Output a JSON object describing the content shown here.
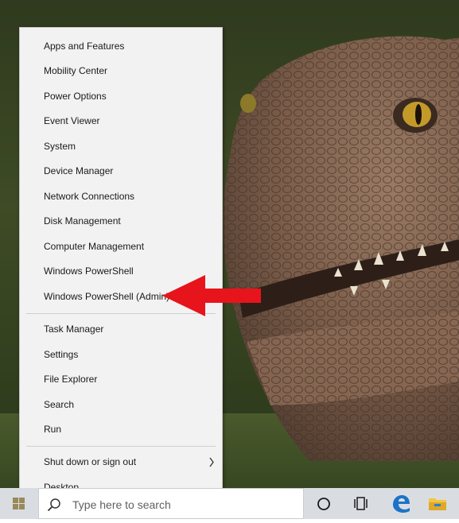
{
  "menu": {
    "groups": [
      [
        "Apps and Features",
        "Mobility Center",
        "Power Options",
        "Event Viewer",
        "System",
        "Device Manager",
        "Network Connections",
        "Disk Management",
        "Computer Management",
        "Windows PowerShell",
        "Windows PowerShell (Admin)"
      ],
      [
        "Task Manager",
        "Settings",
        "File Explorer",
        "Search",
        "Run"
      ],
      [
        "Shut down or sign out",
        "Desktop"
      ]
    ],
    "submenu_item": "Shut down or sign out",
    "highlighted_item": "Windows PowerShell (Admin)"
  },
  "taskbar": {
    "search_placeholder": "Type here to search",
    "icons": [
      "windows-logo-icon",
      "search-icon",
      "cortana-circle-icon",
      "task-view-icon",
      "edge-icon",
      "file-explorer-icon"
    ]
  },
  "colors": {
    "menu_bg": "#f2f2f2",
    "annotation_arrow": "#e8141b",
    "taskbar_bg": "#d9dde2",
    "edge_blue": "#1a73c8",
    "explorer_yellow": "#f4c542"
  }
}
